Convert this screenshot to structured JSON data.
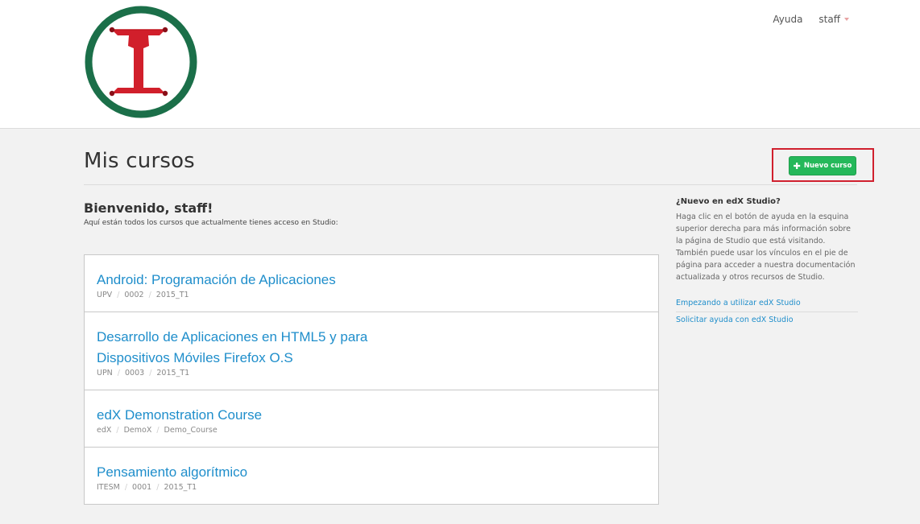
{
  "header": {
    "help_label": "Ayuda",
    "user_label": "staff"
  },
  "main": {
    "page_title": "Mis cursos",
    "new_course_label": "Nuevo curso",
    "welcome_title": "Bienvenido, staff!",
    "welcome_subtitle": "Aquí están todos los cursos que actualmente tienes acceso en Studio:"
  },
  "courses": [
    {
      "title": "Android: Programación de Aplicaciones",
      "org": "UPV",
      "number": "0002",
      "run": "2015_T1"
    },
    {
      "title": "Desarrollo de Aplicaciones en HTML5 y para Dispositivos Móviles Firefox O.S",
      "org": "UPN",
      "number": "0003",
      "run": "2015_T1"
    },
    {
      "title": "edX Demonstration Course",
      "org": "edX",
      "number": "DemoX",
      "run": "Demo_Course"
    },
    {
      "title": "Pensamiento algorítmico",
      "org": "ITESM",
      "number": "0001",
      "run": "2015_T1"
    }
  ],
  "sidebar": {
    "title": "¿Nuevo en edX Studio?",
    "body": "Haga clic en el botón de ayuda en la esquina superior derecha para más información sobre la página de Studio que está visitando. También puede usar los vínculos en el pie de página para acceder a nuestra documentación actualizada y otros recursos de Studio.",
    "links": [
      "Empezando a utilizar edX Studio",
      "Solicitar ayuda con edX Studio"
    ]
  },
  "colors": {
    "logo_ring": "#1b6f49",
    "logo_glyph": "#d11f2b",
    "primary_button": "#25b85a",
    "link": "#1f8ecb",
    "highlight_box": "#d0202e"
  },
  "icons": {
    "logo": "i-beam-logo",
    "new_course": "plus-icon",
    "user_menu": "caret-down-icon"
  }
}
